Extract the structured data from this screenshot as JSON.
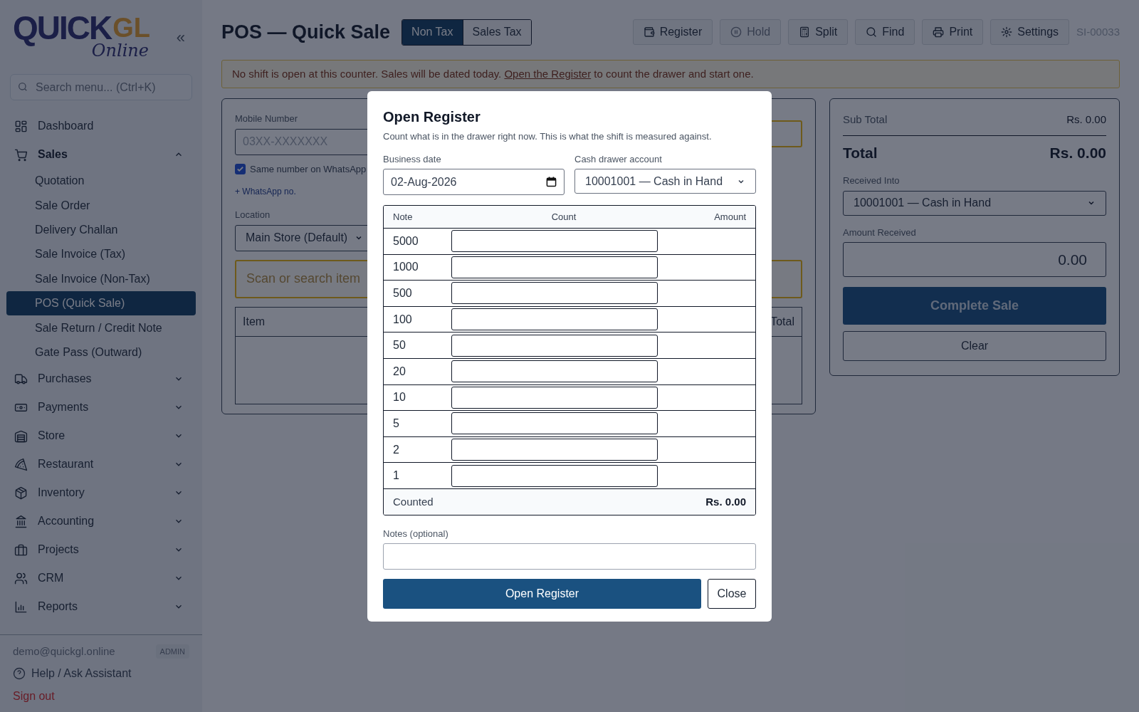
{
  "sidebar": {
    "logo": {
      "word": "QUICK",
      "accent": "GL",
      "tagline": "Online"
    },
    "collapse": "«",
    "search": {
      "placeholder": "Search menu... (Ctrl+K)"
    },
    "items": [
      {
        "label": "Dashboard"
      },
      {
        "label": "Sales",
        "expanded": true,
        "children": [
          {
            "label": "Quotation",
            "selected": false
          },
          {
            "label": "Sale Order",
            "selected": false
          },
          {
            "label": "Delivery Challan",
            "selected": false
          },
          {
            "label": "Sale Invoice (Tax)",
            "selected": false
          },
          {
            "label": "Sale Invoice (Non-Tax)",
            "selected": false
          },
          {
            "label": "POS (Quick Sale)",
            "selected": true
          },
          {
            "label": "Sale Return / Credit Note",
            "selected": false
          },
          {
            "label": "Gate Pass (Outward)",
            "selected": false
          }
        ]
      },
      {
        "label": "Purchases",
        "expanded": false
      },
      {
        "label": "Payments",
        "expanded": false
      },
      {
        "label": "Store",
        "expanded": false
      },
      {
        "label": "Restaurant",
        "expanded": false
      },
      {
        "label": "Inventory",
        "expanded": false
      },
      {
        "label": "Accounting",
        "expanded": false
      },
      {
        "label": "Projects",
        "expanded": false
      },
      {
        "label": "CRM",
        "expanded": false
      },
      {
        "label": "Reports",
        "expanded": false
      }
    ],
    "user": {
      "email": "demo@quickgl.online",
      "role": "ADMIN"
    },
    "help": "Help / Ask Assistant",
    "sign_out": "Sign out"
  },
  "header": {
    "title": "POS — Quick Sale",
    "tax_modes": [
      {
        "label": "Non Tax",
        "selected": true
      },
      {
        "label": "Sales Tax",
        "selected": false
      }
    ],
    "actions": [
      {
        "label": "Register",
        "disabled": false
      },
      {
        "label": "Hold",
        "disabled": true
      },
      {
        "label": "Split",
        "disabled": false
      },
      {
        "label": "Find",
        "disabled": false
      },
      {
        "label": "Print",
        "disabled": false
      },
      {
        "label": "Settings",
        "disabled": false
      }
    ],
    "invoice_no": "SI-00033"
  },
  "alert": {
    "before": "No shift is open at this counter. Sales will be dated today. ",
    "link": "Open the Register",
    "after": " to count the drawer and start one."
  },
  "customer": {
    "mobile_label": "Mobile Number",
    "mobile_placeholder": "03XX-XXXXXXX",
    "same_whatsapp": {
      "label": "Same number on WhatsApp",
      "checked": true
    },
    "add_whatsapp": "+ WhatsApp no.",
    "location_label": "Location",
    "location": "Main Store (Default)",
    "scan_placeholder": "Scan or search item",
    "columns": [
      "Item",
      "Total"
    ]
  },
  "summary": {
    "subtotal_label": "Sub Total",
    "subtotal": "Rs. 0.00",
    "total_label": "Total",
    "total": "Rs. 0.00",
    "received_into_label": "Received Into",
    "received_into": "10001001 — Cash in Hand",
    "amount_label": "Amount Received",
    "amount": "0.00",
    "complete": "Complete Sale",
    "clear": "Clear"
  },
  "modal": {
    "title": "Open Register",
    "description": "Count what is in the drawer right now. This is what the shift is measured against.",
    "date_label": "Business date",
    "date": "02-Aug-2026",
    "account_label": "Cash drawer account",
    "account": "10001001 — Cash in Hand",
    "columns": [
      "Note",
      "Count",
      "Amount"
    ],
    "notes": [
      "5000",
      "1000",
      "500",
      "100",
      "50",
      "20",
      "10",
      "5",
      "2",
      "1"
    ],
    "counted_label": "Counted",
    "counted": "Rs. 0.00",
    "notes_label": "Notes (optional)",
    "submit": "Open Register",
    "close": "Close"
  }
}
